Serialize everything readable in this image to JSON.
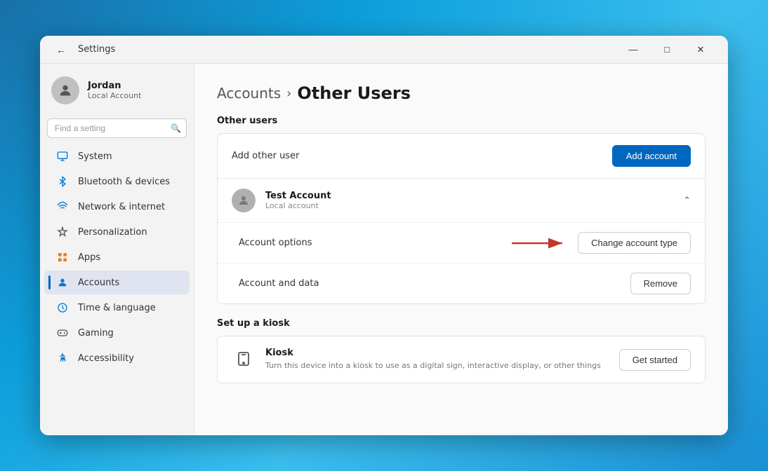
{
  "window": {
    "title": "Settings",
    "controls": {
      "minimize": "—",
      "maximize": "□",
      "close": "✕"
    }
  },
  "sidebar": {
    "user": {
      "name": "Jordan",
      "type": "Local Account"
    },
    "search": {
      "placeholder": "Find a setting"
    },
    "nav": [
      {
        "id": "system",
        "label": "System",
        "icon": "monitor"
      },
      {
        "id": "bluetooth",
        "label": "Bluetooth & devices",
        "icon": "bluetooth"
      },
      {
        "id": "network",
        "label": "Network & internet",
        "icon": "network"
      },
      {
        "id": "personalization",
        "label": "Personalization",
        "icon": "brush"
      },
      {
        "id": "apps",
        "label": "Apps",
        "icon": "apps"
      },
      {
        "id": "accounts",
        "label": "Accounts",
        "icon": "person",
        "active": true
      },
      {
        "id": "time",
        "label": "Time & language",
        "icon": "clock"
      },
      {
        "id": "gaming",
        "label": "Gaming",
        "icon": "gaming"
      },
      {
        "id": "accessibility",
        "label": "Accessibility",
        "icon": "accessibility"
      }
    ]
  },
  "main": {
    "breadcrumb": {
      "parent": "Accounts",
      "separator": "›",
      "current": "Other Users"
    },
    "other_users_section": {
      "title": "Other users",
      "add_row": {
        "label": "Add other user",
        "button": "Add account"
      }
    },
    "test_account": {
      "name": "Test Account",
      "type": "Local account",
      "options_label": "Account options",
      "change_type_btn": "Change account type",
      "data_label": "Account and data",
      "remove_btn": "Remove"
    },
    "kiosk_section": {
      "title": "Set up a kiosk",
      "name": "Kiosk",
      "description": "Turn this device into a kiosk to use as a digital sign, interactive display, or other things",
      "button": "Get started"
    }
  }
}
